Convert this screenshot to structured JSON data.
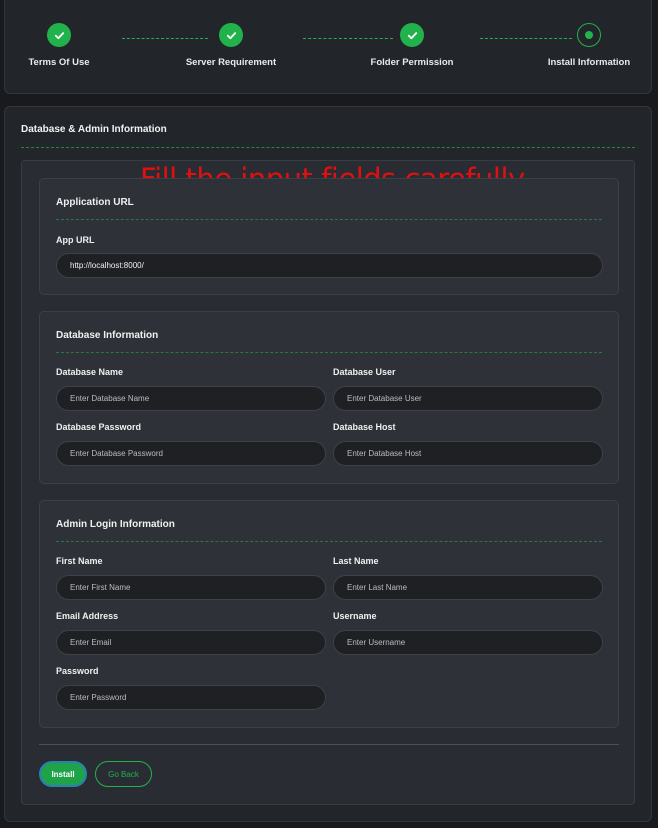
{
  "stepper": {
    "steps": [
      {
        "label": "Terms Of Use",
        "status": "done"
      },
      {
        "label": "Server Requirement",
        "status": "done"
      },
      {
        "label": "Folder Permission",
        "status": "done"
      },
      {
        "label": "Install Information",
        "status": "active"
      }
    ]
  },
  "card": {
    "title": "Database & Admin Information",
    "overlay": "Fill the input fields carefully"
  },
  "app_section": {
    "title": "Application URL",
    "app_url_label": "App URL",
    "app_url_value": "http://localhost:8000/"
  },
  "db_section": {
    "title": "Database Information",
    "name_label": "Database Name",
    "name_placeholder": "Enter Database Name",
    "user_label": "Database User",
    "user_placeholder": "Enter Database User",
    "password_label": "Database Password",
    "password_placeholder": "Enter Database Password",
    "host_label": "Database Host",
    "host_placeholder": "Enter Database Host"
  },
  "admin_section": {
    "title": "Admin Login Information",
    "first_name_label": "First Name",
    "first_name_placeholder": "Enter First Name",
    "last_name_label": "Last Name",
    "last_name_placeholder": "Enter Last Name",
    "email_label": "Email Address",
    "email_placeholder": "Enter Email",
    "username_label": "Username",
    "username_placeholder": "Enter Username",
    "password_label": "Password",
    "password_placeholder": "Enter Password"
  },
  "actions": {
    "install_label": "Install",
    "back_label": "Go Back"
  },
  "colors": {
    "accent": "#22b24c",
    "background": "#181a1e",
    "card": "#22252a",
    "overlay_text": "#e01010"
  }
}
